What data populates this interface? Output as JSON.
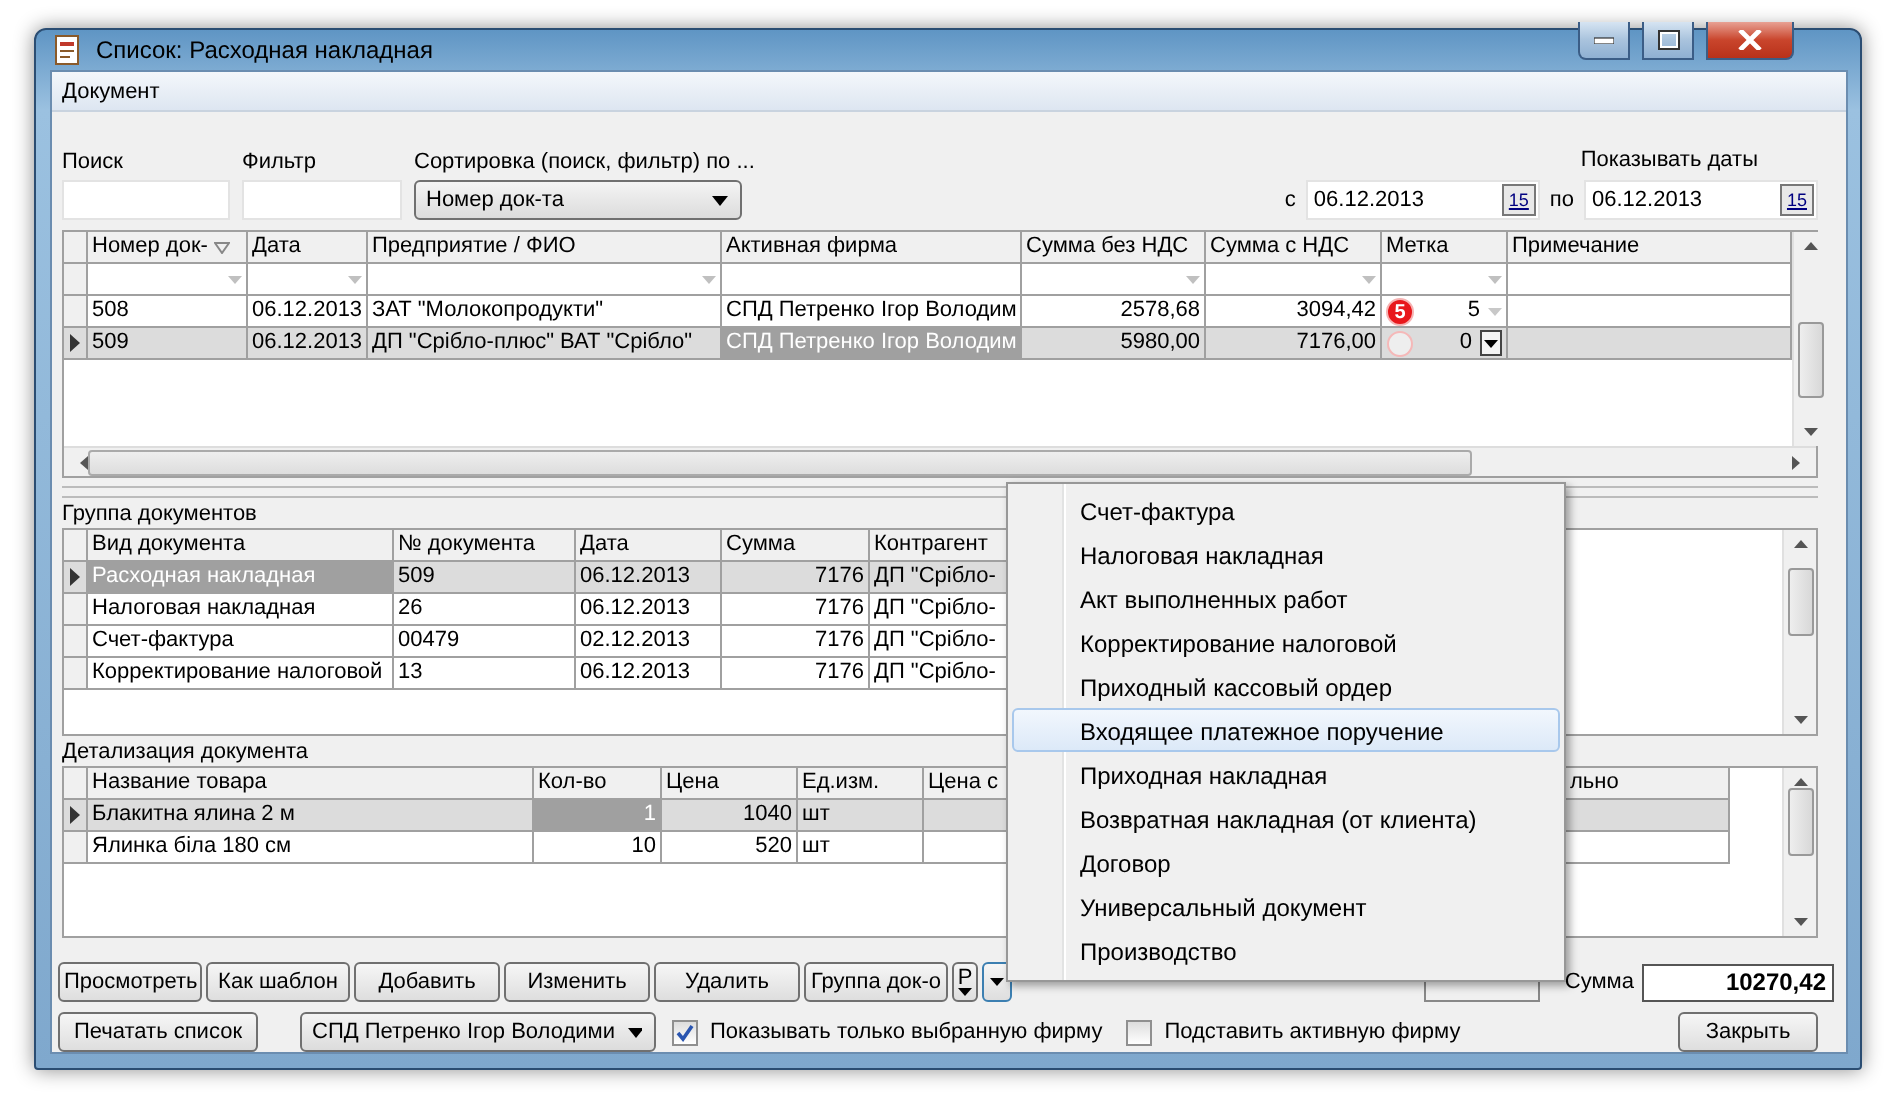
{
  "window": {
    "title": "Список: Расходная накладная"
  },
  "menu_bar": [
    {
      "label": "Документ"
    }
  ],
  "search": {
    "label": "Поиск"
  },
  "filter": {
    "label": "Фильтр"
  },
  "sort": {
    "label": "Сортировка (поиск, фильтр) по ...",
    "value": "Номер док-та"
  },
  "dates": {
    "label": "Показывать даты",
    "from_label": "с",
    "from": "06.12.2013",
    "to_label": "по",
    "to": "06.12.2013",
    "from_calendar": "15",
    "to_calendar": "15"
  },
  "documents_table": {
    "columns": [
      {
        "label": "Номер док-",
        "kind": "text",
        "sorted": true,
        "filter_arrow": true,
        "focused": false
      },
      {
        "label": "Дата",
        "kind": "text",
        "sorted": false,
        "filter_arrow": true,
        "focused": false
      },
      {
        "label": "Предприятие / ФИО",
        "kind": "text",
        "sorted": false,
        "filter_arrow": true,
        "focused": false
      },
      {
        "label": "Активная фирма",
        "kind": "text",
        "sorted": false,
        "filter_arrow": false,
        "focused": true
      },
      {
        "label": "Сумма без НДС",
        "kind": "number",
        "sorted": false,
        "filter_arrow": true,
        "focused": false
      },
      {
        "label": "Сумма с НДС",
        "kind": "number",
        "sorted": false,
        "filter_arrow": true,
        "focused": false
      },
      {
        "label": "Метка",
        "kind": "mark",
        "sorted": false,
        "filter_arrow": true,
        "focused": false
      },
      {
        "label": "Примечание",
        "kind": "text",
        "sorted": false,
        "filter_arrow": false,
        "focused": false
      }
    ],
    "rows": [
      {
        "selected": false,
        "badge": "5",
        "cells": [
          "508",
          "06.12.2013",
          "ЗАТ \"Молокопродукти\"",
          "СПД Петренко Ігор Володим",
          "2578,68",
          "3094,42",
          "5"
        ]
      },
      {
        "selected": true,
        "cells": [
          "509",
          "06.12.2013",
          "ДП \"Срібло-плюс\" ВАТ \"Срібло\"",
          "СПД Петренко Ігор Володим",
          "5980,00",
          "7176,00",
          "0"
        ]
      }
    ]
  },
  "group_table": {
    "title": "Группа документов",
    "columns": [
      {
        "label": "Вид документа",
        "kind": "text",
        "focused": true
      },
      {
        "label": "№ документа",
        "kind": "text",
        "focused": false
      },
      {
        "label": "Дата",
        "kind": "text",
        "focused": false
      },
      {
        "label": "Сумма",
        "kind": "number",
        "focused": false
      },
      {
        "label": "Контрагент",
        "kind": "text",
        "focused": false
      }
    ],
    "rows": [
      {
        "selected": true,
        "cells": [
          "Расходная накладная",
          "509",
          "06.12.2013",
          "7176",
          "ДП \"Срібло-"
        ]
      },
      {
        "selected": false,
        "cells": [
          "Налоговая накладная",
          "26",
          "06.12.2013",
          "7176",
          "ДП \"Срібло-"
        ]
      },
      {
        "selected": false,
        "cells": [
          "Счет-фактура",
          "00479",
          "02.12.2013",
          "7176",
          "ДП \"Срібло-"
        ]
      },
      {
        "selected": false,
        "cells": [
          "Корректирование налоговой",
          "13",
          "06.12.2013",
          "7176",
          "ДП \"Срібло-"
        ]
      }
    ]
  },
  "detail_table": {
    "title": "Детализация документа",
    "columns": [
      {
        "label": "Название товара",
        "kind": "text",
        "focused": false
      },
      {
        "label": "Кол-во",
        "kind": "number",
        "focused": true
      },
      {
        "label": "Цена",
        "kind": "number",
        "focused": false
      },
      {
        "label": "Ед.изм.",
        "kind": "text",
        "focused": false
      },
      {
        "label": "Цена с",
        "kind": "text",
        "focused": false
      },
      {
        "label": "льно",
        "kind": "text",
        "focused": false
      }
    ],
    "rows": [
      {
        "selected": true,
        "cells": [
          "Блакитна ялина 2 м",
          "1",
          "1040",
          "шт"
        ]
      },
      {
        "selected": false,
        "cells": [
          "Ялинка біла 180 см",
          "10",
          "520",
          "шт"
        ]
      }
    ]
  },
  "buttons": [
    {
      "label": "Просмотреть"
    },
    {
      "label": "Как шаблон"
    },
    {
      "label": "Добавить"
    },
    {
      "label": "Изменить"
    },
    {
      "label": "Удалить"
    },
    {
      "label": "Группа док-о"
    },
    {
      "label": "Р"
    }
  ],
  "total": {
    "label": "Сумма",
    "value": "10270,42"
  },
  "print_button": {
    "label": "Печатать список"
  },
  "firm_select": {
    "value": "СПД Петренко Ігор Володими"
  },
  "checkboxes": [
    {
      "label": "Показывать только выбранную фирму",
      "checked": true
    },
    {
      "label": "Подставить активную фирму",
      "checked": false
    }
  ],
  "close_button": {
    "label": "Закрыть"
  },
  "popup_menu": [
    {
      "label": "Счет-фактура",
      "selected": false
    },
    {
      "label": "Налоговая накладная",
      "selected": false
    },
    {
      "label": "Акт выполненных работ",
      "selected": false
    },
    {
      "label": "Корректирование налоговой",
      "selected": false
    },
    {
      "label": "Приходный кассовый ордер",
      "selected": false
    },
    {
      "label": "Входящее платежное поручение",
      "selected": true
    },
    {
      "label": "Приходная накладная",
      "selected": false
    },
    {
      "label": "Возвратная накладная (от клиента)",
      "selected": false
    },
    {
      "label": "Договор",
      "selected": false
    },
    {
      "label": "Универсальный документ",
      "selected": false
    },
    {
      "label": "Производство",
      "selected": false
    }
  ]
}
